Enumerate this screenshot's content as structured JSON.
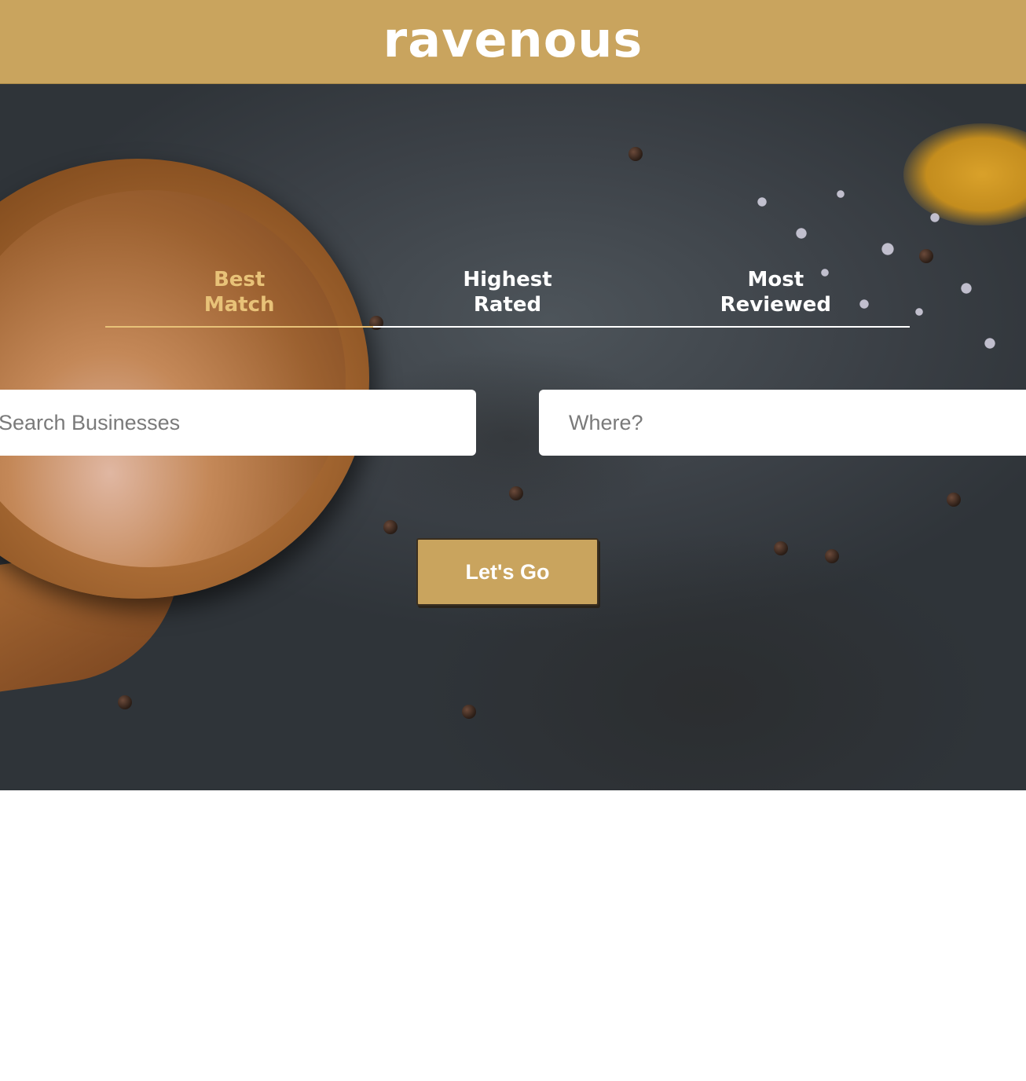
{
  "app": {
    "logo_text": "ravenous"
  },
  "colors": {
    "brand": "#c9a45e",
    "active_tab": "#e8c278"
  },
  "sort_tabs": [
    {
      "label_line1": "Best",
      "label_line2": "Match",
      "active": true
    },
    {
      "label_line1": "Highest",
      "label_line2": "Rated",
      "active": false
    },
    {
      "label_line1": "Most",
      "label_line2": "Reviewed",
      "active": false
    }
  ],
  "search": {
    "business_placeholder": "Search Businesses",
    "location_placeholder": "Where?",
    "submit_label": "Let's Go"
  }
}
